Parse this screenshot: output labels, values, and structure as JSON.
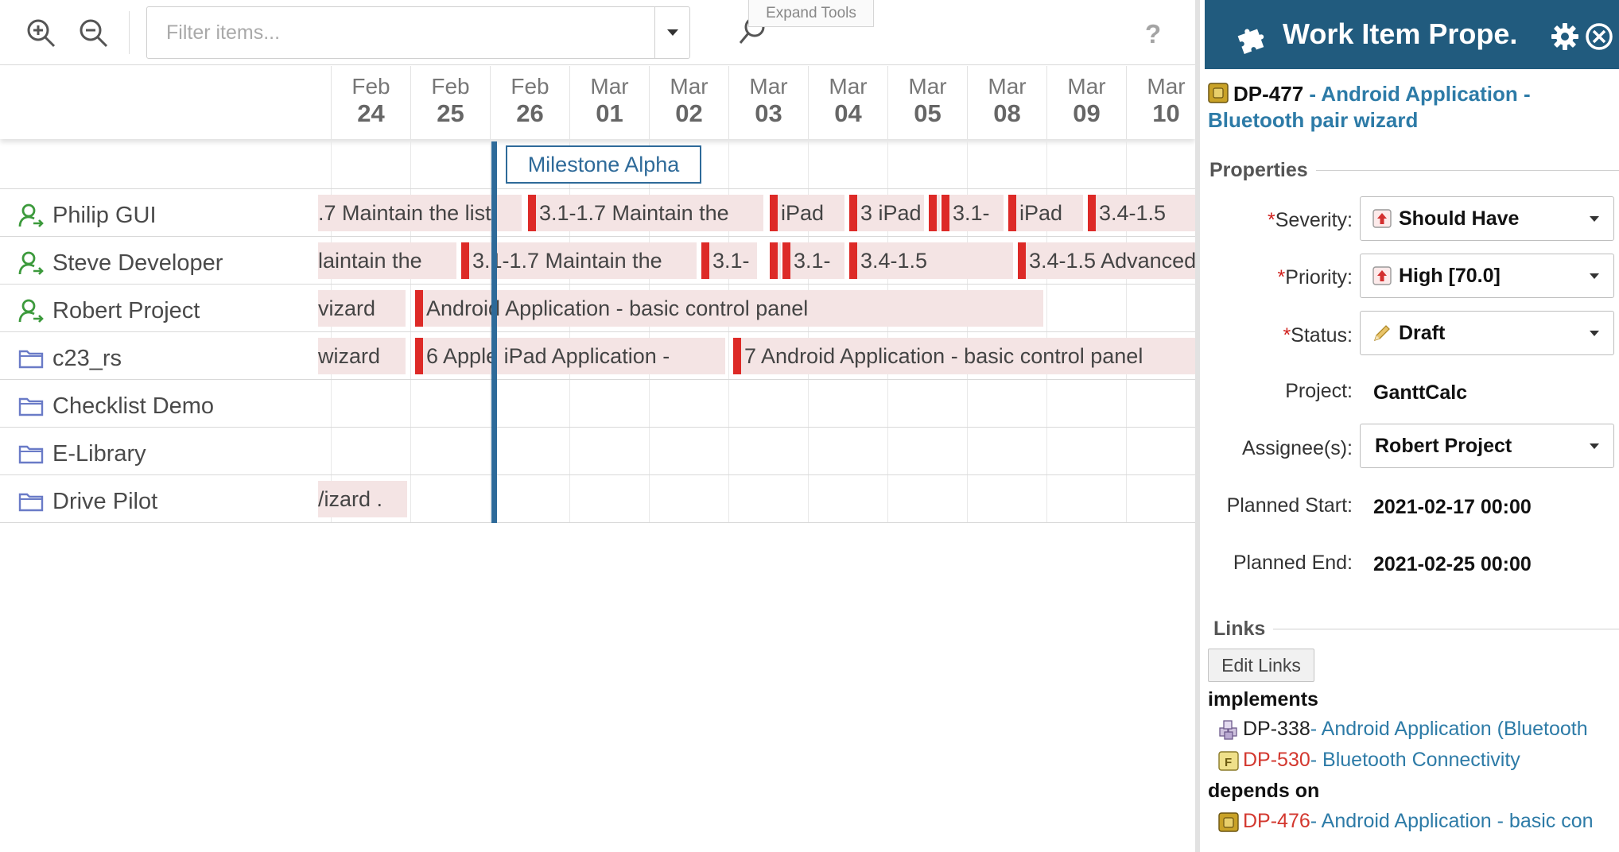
{
  "toolbar": {
    "filter_placeholder": "Filter items...",
    "expand_tools_label": "Expand Tools",
    "help_label": "?"
  },
  "timeline": {
    "dates": [
      {
        "month": "Feb",
        "day": "24"
      },
      {
        "month": "Feb",
        "day": "25"
      },
      {
        "month": "Feb",
        "day": "26"
      },
      {
        "month": "Mar",
        "day": "01"
      },
      {
        "month": "Mar",
        "day": "02"
      },
      {
        "month": "Mar",
        "day": "03"
      },
      {
        "month": "Mar",
        "day": "04"
      },
      {
        "month": "Mar",
        "day": "05"
      },
      {
        "month": "Mar",
        "day": "08"
      },
      {
        "month": "Mar",
        "day": "09"
      },
      {
        "month": "Mar",
        "day": "10"
      }
    ],
    "milestone_label": "Milestone Alpha"
  },
  "rows": [
    {
      "label": "Philip GUI",
      "icon": "user-icon"
    },
    {
      "label": "Steve Developer",
      "icon": "user-icon"
    },
    {
      "label": "Robert Project",
      "icon": "user-icon"
    },
    {
      "label": "c23_rs",
      "icon": "folder-icon"
    },
    {
      "label": "Checklist Demo",
      "icon": "folder-icon"
    },
    {
      "label": "E-Library",
      "icon": "folder-icon"
    },
    {
      "label": "Drive Pilot",
      "icon": "folder-icon"
    }
  ],
  "bars": {
    "philip": [
      ".7 Maintain the list",
      "3.1-1.7 Maintain the",
      "iPad",
      "3 iPad",
      "",
      "3.1-",
      "iPad",
      "3.4-1.5"
    ],
    "steve": [
      "laintain the",
      "3.1-1.7 Maintain the",
      "3.1-",
      "",
      "3.1-",
      "3.4-1.5",
      "3.4-1.5 Advanced"
    ],
    "robert": [
      "vizard",
      "Android Application - basic control panel"
    ],
    "c23": [
      " wizard",
      "6 Apple iPad Application -",
      "7 Android Application - basic control panel"
    ],
    "drive": [
      "/izard ."
    ]
  },
  "panel": {
    "title": "Work Item Prope.",
    "item_key": "DP-477",
    "item_name": " - Android Application - Bluetooth pair wizard",
    "properties_header": "Properties",
    "required_mark": "*",
    "severity": {
      "label": "Severity:",
      "value": "Should Have"
    },
    "priority": {
      "label": "Priority:",
      "value": "High [70.0]"
    },
    "status": {
      "label": "Status:",
      "value": "Draft"
    },
    "project": {
      "label": "Project:",
      "value": "GanttCalc"
    },
    "assignees": {
      "label": "Assignee(s):",
      "value": "Robert Project"
    },
    "planned_start": {
      "label": "Planned Start:",
      "value": "2021-02-17 00:00"
    },
    "planned_end": {
      "label": "Planned End:",
      "value": "2021-02-25 00:00"
    },
    "links_header": "Links",
    "edit_links_label": "Edit Links",
    "implements_label": "implements",
    "implements": [
      {
        "key": "DP-338",
        "text": " - Android Application (Bluetooth",
        "key_color": "dark",
        "icon": "package-icon"
      },
      {
        "key": "DP-530",
        "text": " - Bluetooth Connectivity",
        "key_color": "red",
        "icon": "feature-icon"
      }
    ],
    "depends_on_label": "depends on",
    "depends_on": [
      {
        "key": "DP-476",
        "text": " - Android Application - basic con",
        "key_color": "red",
        "icon": "workitem-icon"
      }
    ]
  },
  "colors": {
    "panel_header": "#215b7e",
    "milestone": "#2e6a99",
    "bar_fill": "#f4e4e4",
    "bar_mark": "#dd2a27",
    "link": "#2d7ba7",
    "key_red": "#d3382f"
  }
}
